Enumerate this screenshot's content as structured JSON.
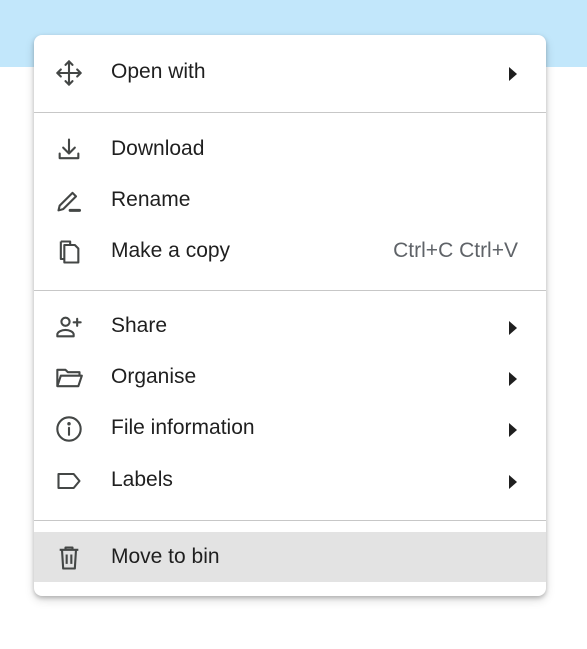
{
  "menu": {
    "items": [
      {
        "label": "Open with",
        "icon": "move-arrows-icon",
        "submenu": true
      },
      {
        "label": "Download",
        "icon": "download-icon"
      },
      {
        "label": "Rename",
        "icon": "pencil-icon"
      },
      {
        "label": "Make a copy",
        "icon": "copy-icon",
        "shortcut": "Ctrl+C Ctrl+V"
      },
      {
        "label": "Share",
        "icon": "person-add-icon",
        "submenu": true
      },
      {
        "label": "Organise",
        "icon": "folder-open-icon",
        "submenu": true
      },
      {
        "label": "File information",
        "icon": "info-icon",
        "submenu": true
      },
      {
        "label": "Labels",
        "icon": "label-icon",
        "submenu": true
      },
      {
        "label": "Move to bin",
        "icon": "trash-icon",
        "highlighted": true
      }
    ]
  },
  "colors": {
    "background_band": "#c2e7fb",
    "hover": "#e3e3e3",
    "text": "#1f1f1f",
    "shortcut_text": "#5f6368",
    "divider": "#c7c7c7"
  }
}
